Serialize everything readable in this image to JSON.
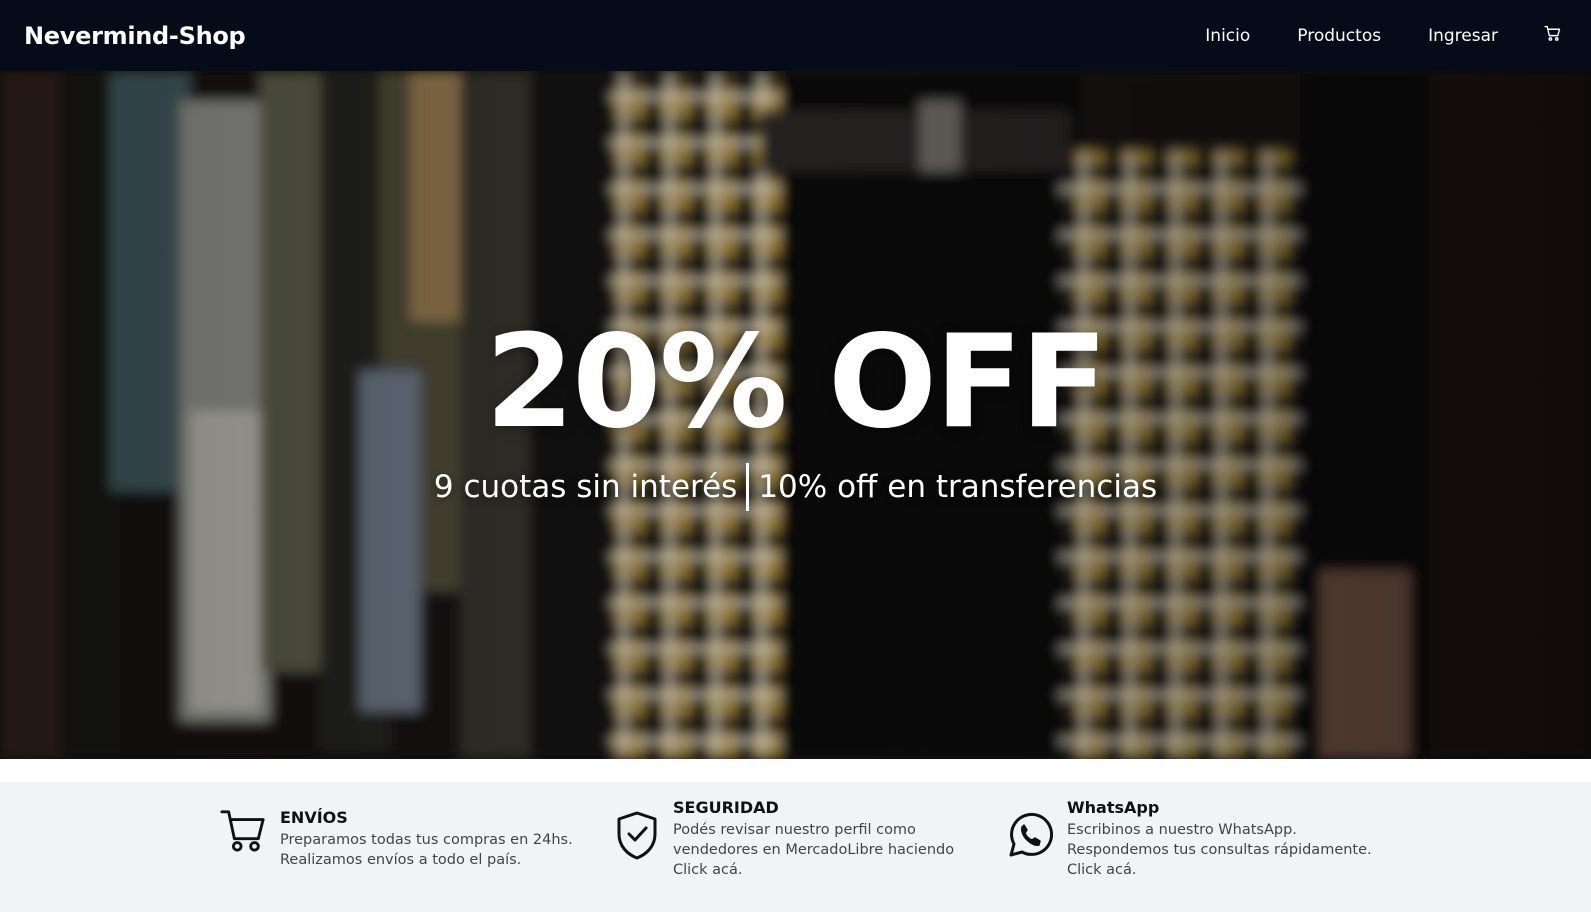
{
  "navbar": {
    "brand": "Nevermind-Shop",
    "links": [
      {
        "label": "Inicio"
      },
      {
        "label": "Productos"
      },
      {
        "label": "Ingresar"
      }
    ],
    "cart_icon": "cart-icon",
    "background": "#050b18"
  },
  "hero": {
    "title": "20% OFF",
    "subtitle_left": "9 cuotas sin interés",
    "subtitle_right": "10% off en transferencias",
    "background_description_icon": "photo-background"
  },
  "features": [
    {
      "icon": "cart-icon",
      "title": "ENVÍOS",
      "lines": [
        "Preparamos todas tus compras en 24hs.",
        "Realizamos envíos a todo el país."
      ]
    },
    {
      "icon": "shield-check-icon",
      "title": "SEGURIDAD",
      "lines": [
        "Podés revisar nuestro perfil como",
        "vendedores en MercadoLibre haciendo",
        "Click acá."
      ]
    },
    {
      "icon": "whatsapp-icon",
      "title": "WhatsApp",
      "lines": [
        "Escribinos a nuestro WhatsApp.",
        "Respondemos tus consultas rápidamente.",
        "Click acá."
      ]
    }
  ],
  "colors": {
    "navbar_bg": "#050b18",
    "features_bg": "#f1f3f5",
    "plaid_yellow": "#d8b24a"
  }
}
